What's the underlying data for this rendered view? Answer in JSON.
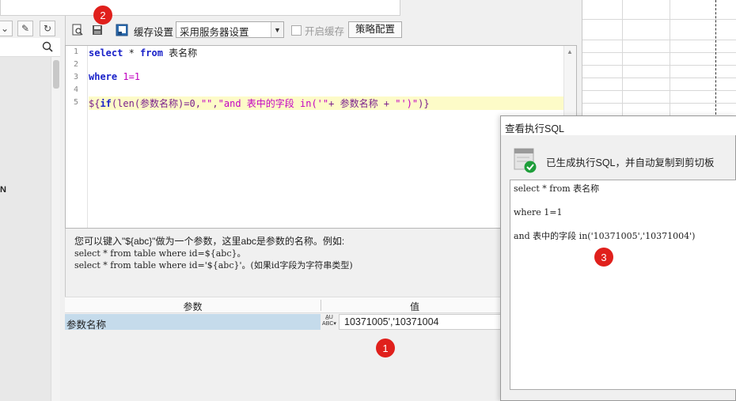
{
  "toolbar": {
    "cache_label": "缓存设置",
    "cache_select_value": "采用服务器设置",
    "enable_cache_label": "开启缓存",
    "strategy_button": "策略配置"
  },
  "editor": {
    "line_numbers": [
      "1",
      "2",
      "3",
      "4",
      "5"
    ],
    "line1": {
      "kw1": "select",
      "mid": " * ",
      "kw2": "from",
      "rest": " 表名称"
    },
    "line3": {
      "kw": "where",
      "rest": " 1=1"
    },
    "line5": {
      "p1": "${",
      "p2": "if",
      "p3": "(",
      "p4": "len",
      "p5": "(参数名称)=0,",
      "p6": "\"\"",
      "p7": ",",
      "p8": "\"and 表中的字段 in('\"",
      "p9": "+ 参数名称 + ",
      "p10": "\"')\"",
      "p11": ")}"
    }
  },
  "help": {
    "line1": "您可以键入\"${abc}\"做为一个参数，这里abc是参数的名称。例如:",
    "line2": "select * from table where id=${abc}。",
    "line3": "select * from table where id='${abc}'。(如果id字段为字符串类型)"
  },
  "params": {
    "header_name": "参数",
    "header_value": "值",
    "row_name": "参数名称",
    "row_value": "10371005','10371004"
  },
  "badges": {
    "b1": "1",
    "b2": "2",
    "b3": "3"
  },
  "sql_popup": {
    "title": "查看执行SQL",
    "status": "已生成执行SQL，并自动复制到剪切板",
    "sql": "select * from 表名称\n\nwhere 1=1\n\nand 表中的字段 in('10371005','10371004')"
  },
  "left": {
    "cut_label": "N"
  },
  "colors": {
    "badge": "#e0201c",
    "selected_row": "#c5dbeb",
    "line_highlight": "#fdfbc8",
    "keyword": "#1a22c9"
  }
}
